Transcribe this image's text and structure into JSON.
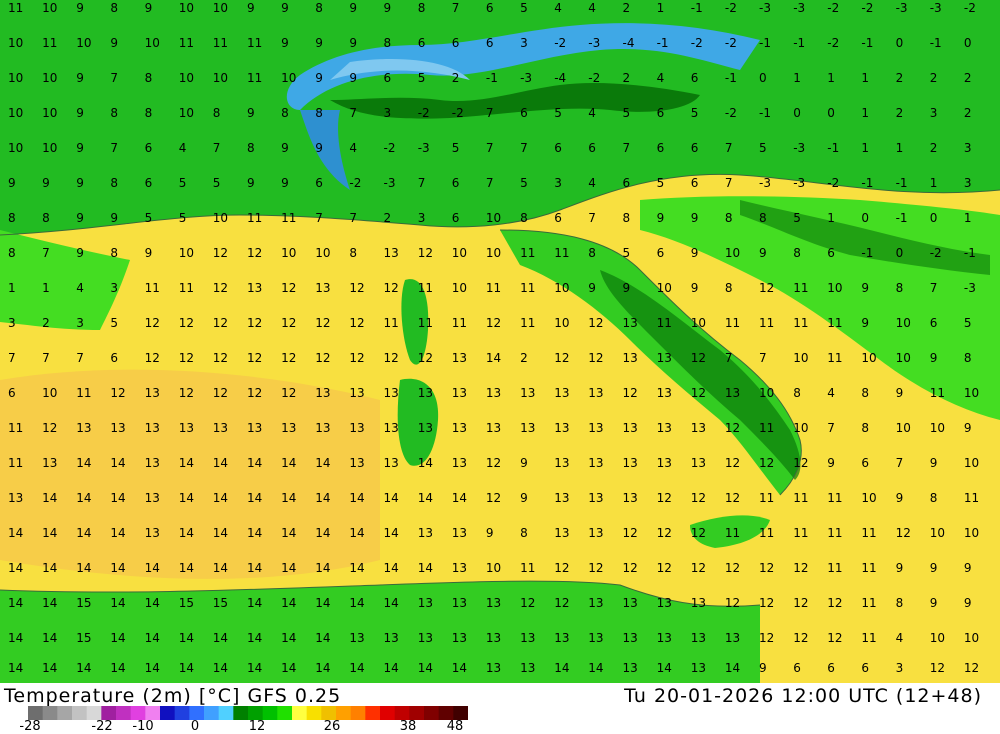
{
  "header": {
    "title": "Temperature (2m) [°C] GFS 0.25",
    "valid_time": "Tu 20-01-2026 12:00 UTC (12+48)"
  },
  "legend": {
    "ticks": [
      "-28",
      "-22",
      "-10",
      "0",
      "12",
      "26",
      "38",
      "48"
    ],
    "colors": [
      "#6e6e6e",
      "#8a8a8a",
      "#a6a6a6",
      "#c2c2c2",
      "#d8d8d8",
      "#a020a0",
      "#c030c0",
      "#e040e0",
      "#f080f0",
      "#1010c0",
      "#2040e0",
      "#3070ff",
      "#40a0ff",
      "#50d0ff",
      "#008000",
      "#00a000",
      "#00c000",
      "#20e000",
      "#ffff40",
      "#f8e000",
      "#f0c000",
      "#ffa000",
      "#ff8000",
      "#ff3000",
      "#e00000",
      "#c00000",
      "#a00000",
      "#800000",
      "#600000",
      "#400000"
    ]
  },
  "colors": {
    "sea_warm": "#f8e040",
    "sea_hot": "#f6c84a",
    "land_cool": "#22bb22",
    "land_mid": "#44dd22",
    "mountain": "#0a7a0a",
    "snow_zone": "#3fa8e6",
    "coast": "#3a6a3a"
  },
  "grid_values": {
    "row_y": [
      8,
      43,
      78,
      113,
      148,
      183,
      218,
      253,
      288,
      323,
      358,
      393,
      428,
      463,
      498,
      533,
      568,
      603,
      638,
      668
    ],
    "rows": [
      "11 10 9 8 9 10 10 9 9 8 9 9 8 7 6 5 4 4 2 1 -1 -2 -3 -3 -2 -2 -3 -3 -2",
      "10 11 10 9 10 11 11 11 9 9 9 8 6 6 6 3 -2 -3 -4 -1 -2 -2 -1 -1 -2 -1 0 -1 0",
      "10 10 9 7 8 10 10 11 10 9 9 6 5 2 -1 -3 -4 -2 2 4 6 -1 0 1 1 1 2 2 2",
      "10 10 9 8 8 10 8 9 8 8 7 3 -2 -2 7 6 5 4 5 6 5 -2 -1 0 0 1 2 3 2",
      "10 10 9 7 6 4 7 8 9 9 4 -2 -3 5 7 7 6 6 7 6 6 7 5 -3 -1 1 1 2 3",
      "9 9 9 8 6 5 5 9 9 6 -2 -3 7 6 7 5 3 4 6 5 6 7 -3 -3 -2 -1 -1 1 3",
      "8 8 9 9 5 5 10 11 11 7 7 2 3 6 10 8 6 7 8 9 9 8 8 5 1 0 -1 0 1",
      "8 7 9 8 9 10 12 12 10 10 8 13 12 10 10 11 11 8 5 6 9 10 9 8 6 -1 0 -2 -1",
      "1 1 4 3 11 11 12 13 12 13 12 12 11 10 11 11 10 9 9 10 9 8 12 11 10 9 8 7 -3",
      "3 2 3 5 12 12 12 12 12 12 12 11 11 11 12 11 10 12 13 11 10 11 11 11 11 9 10 6 5",
      "7 7 7 6 12 12 12 12 12 12 12 12 12 13 14 2 12 12 13 13 12 7 7 10 11 10 10 9 8",
      "6 10 11 12 13 12 12 12 12 13 13 13 13 13 13 13 13 13 12 13 12 13 10 8 4 8 9 11 10",
      "11 12 13 13 13 13 13 13 13 13 13 13 13 13 13 13 13 13 13 13 13 12 11 10 7 8 10 10 9",
      "11 13 14 14 13 14 14 14 14 14 13 13 14 13 12 9 13 13 13 13 13 12 12 12 9 6 7 9 10",
      "13 14 14 14 13 14 14 14 14 14 14 14 14 14 12 9 13 13 13 12 12 12 11 11 11 10 9 8 11",
      "14 14 14 14 13 14 14 14 14 14 14 14 13 13 9 8 13 13 12 12 12 11 11 11 11 11 12 10 10",
      "14 14 14 14 14 14 14 14 14 14 14 14 14 13 10 11 12 12 12 12 12 12 12 12 11 11 9 9 9",
      "14 14 15 14 14 15 15 14 14 14 14 14 13 13 13 12 12 13 13 13 13 12 12 12 12 11 8 9 9",
      "14 14 15 14 14 14 14 14 14 14 13 13 13 13 13 13 13 13 13 13 13 13 12 12 12 11 4 10 10",
      "14 14 14 14 14 14 14 14 14 14 14 14 14 14 13 13 14 14 13 14 13 14 9 6 6 6 3 12 12"
    ]
  }
}
